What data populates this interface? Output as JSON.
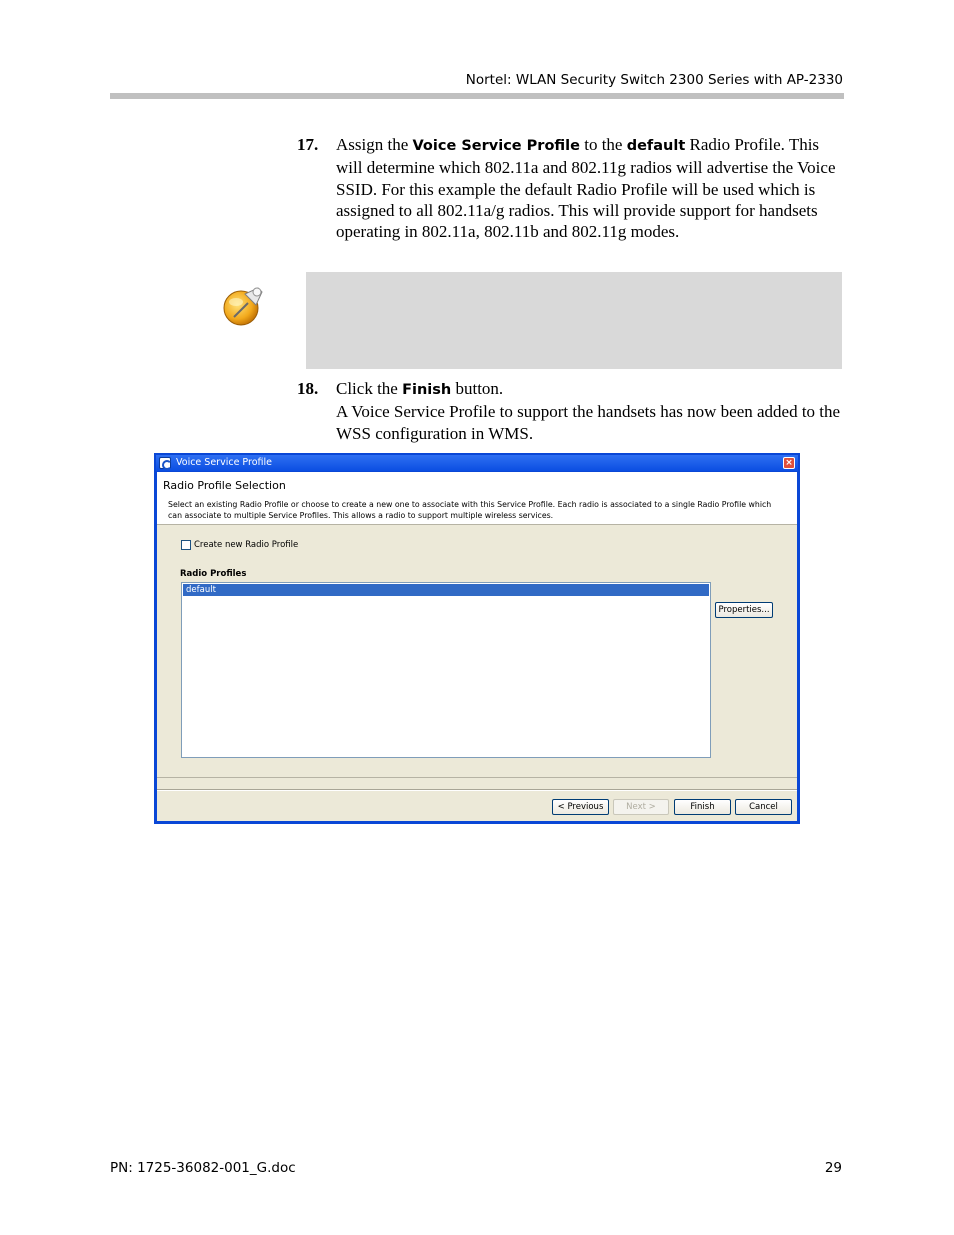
{
  "header": {
    "title": "Nortel: WLAN Security Switch 2300 Series with AP-2330"
  },
  "steps": [
    {
      "number": "17.",
      "p1_a": "Assign the ",
      "p1_kw1": "Voice Service Profile",
      "p1_b": " to the ",
      "p1_kw2": "default",
      "p1_c": " Radio Profile. This will determine which 802.11a and 802.11g radios will advertise the Voice SSID. For this example the default Radio Profile will be used which is assigned to all 802.11a/g radios. This will provide support for handsets operating in 802.11a, 802.11b and 802.11g modes."
    },
    {
      "number": "18.",
      "p1_a": "Click the ",
      "p1_kw1": "Finish",
      "p1_b": " button.",
      "p2": "A Voice Service Profile to support the handsets has now been added to the WSS configuration in WMS."
    }
  ],
  "note": {
    "icon": "pushpin-note-icon"
  },
  "dialog": {
    "title": "Voice Service Profile",
    "heading": "Radio Profile Selection",
    "description": "Select an existing Radio Profile or choose to create a new one to associate with this Service Profile. Each radio is associated to a single Radio Profile which can associate to multiple Service Profiles. This allows a radio to support multiple wireless services.",
    "checkbox_label": "Create new Radio Profile",
    "checkbox_checked": false,
    "list_label": "Radio Profiles",
    "list_items": [
      "default"
    ],
    "selected_item": "default",
    "buttons": {
      "properties": "Properties...",
      "previous": "< Previous",
      "next": "Next >",
      "finish": "Finish",
      "cancel": "Cancel"
    }
  },
  "footer": {
    "doc_id": "PN: 1725-36082-001_G.doc",
    "page_number": "29"
  }
}
